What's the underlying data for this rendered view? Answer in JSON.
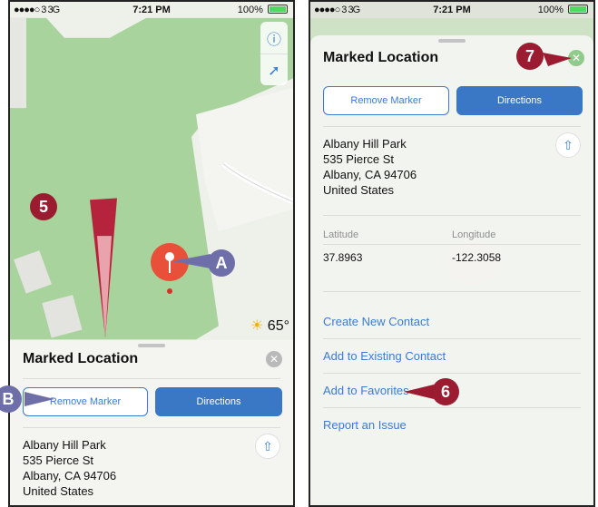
{
  "status_bar": {
    "signal": "●●●●○ 3  3G",
    "signal_right": "●●●●○ 3  3G",
    "time": "7:21 PM",
    "battery": "100%"
  },
  "weather": {
    "temp": "65°"
  },
  "card": {
    "title": "Marked Location",
    "remove_label": "Remove Marker",
    "directions_label": "Directions",
    "address": [
      "Albany Hill Park",
      "535 Pierce St",
      "Albany, CA  94706",
      "United States"
    ]
  },
  "coords": {
    "lat_label": "Latitude",
    "lon_label": "Longitude",
    "lat": "37.8963",
    "lon": "-122.3058"
  },
  "actions": [
    "Create New Contact",
    "Add to Existing Contact",
    "Add to Favorites",
    "Report an Issue"
  ],
  "callouts": {
    "a": "A",
    "b": "B",
    "five": "5",
    "six": "6",
    "seven": "7"
  },
  "colors": {
    "accent": "#3a7bd5",
    "pin": "#e8503a",
    "callout_red": "#9b1b30",
    "callout_purple": "#6e6fa8",
    "park_green": "#a9d39c"
  },
  "icons": {
    "info": "info-icon",
    "location": "location-arrow-icon",
    "share": "share-icon",
    "close": "close-icon",
    "sun": "sun-icon"
  }
}
